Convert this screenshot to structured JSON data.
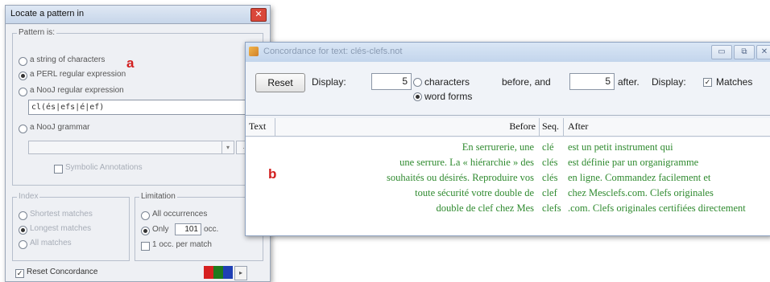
{
  "dialog": {
    "title": "Locate a pattern in",
    "close_glyph": "✕",
    "pattern_group_title": "Pattern is:",
    "options": {
      "string": "a string of characters",
      "perl": "a PERL regular expression",
      "nooj_regex": "a NooJ regular expression",
      "nooj_grammar": "a NooJ grammar"
    },
    "regex_value": "cl(és|efs|é|ef)",
    "combo_value": "",
    "combo_button": "...",
    "symbolic_annotations_label": "Symbolic Annotations",
    "index_group_title": "Index",
    "index_options": [
      "Shortest matches",
      "Longest matches",
      "All matches"
    ],
    "limitation_group_title": "Limitation",
    "limitation_all": "All occurrences",
    "limitation_only": "Only",
    "limitation_only_value": "101",
    "limitation_only_unit": "occ.",
    "limitation_random": "1 occ. per match",
    "reset_concordance_label": "Reset Concordance",
    "swatch_colors": [
      "#d62020",
      "#1d7a1d",
      "#1f3fb5"
    ],
    "marker": "a"
  },
  "concordance": {
    "title": "Concordance for text: clés-clefs.not",
    "title_buttons": [
      "▭",
      "⧉",
      "✕"
    ],
    "reset_label": "Reset",
    "display_label": "Display:",
    "before_value": "5",
    "characters_label": "characters",
    "word_forms_label": "word forms",
    "before_and_label": "before, and",
    "after_value": "5",
    "after_label": "after.",
    "display2_label": "Display:",
    "matches_label": "Matches",
    "columns": {
      "text": "Text",
      "before": "Before",
      "seq": "Seq.",
      "after": "After"
    },
    "rows": [
      {
        "before": "En serrurerie, une",
        "seq": "clé",
        "after": "est un petit instrument qui"
      },
      {
        "before": "une serrure. La « hiérarchie » des",
        "seq": "clés",
        "after": "est définie par un organigramme"
      },
      {
        "before": "souhaités ou désirés. Reproduire vos",
        "seq": "clés",
        "after": "en ligne. Commandez facilement et"
      },
      {
        "before": "toute sécurité votre double de",
        "seq": "clef",
        "after": "chez Mesclefs.com. Clefs originales"
      },
      {
        "before": "double de clef chez Mes",
        "seq": "clefs",
        "after": ".com. Clefs originales certifiées directement"
      }
    ],
    "row_color": "#2f8a2f",
    "marker": "b",
    "marker_color": "#d21f1f"
  }
}
